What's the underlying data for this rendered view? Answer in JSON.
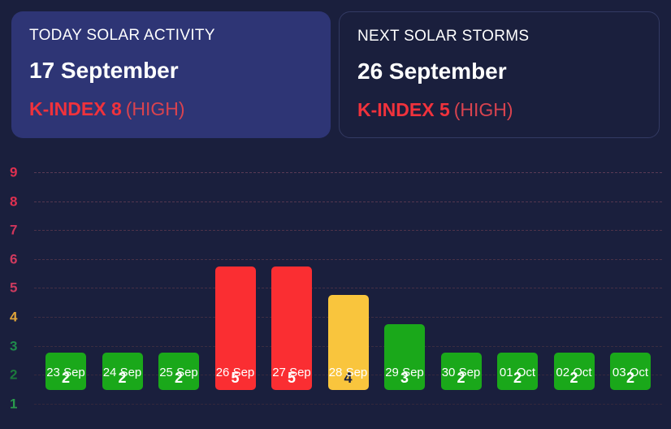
{
  "cards": [
    {
      "title": "TODAY SOLAR ACTIVITY",
      "date": "17 September",
      "kindex": "K-INDEX 8",
      "level": "(HIGH)",
      "style": "filled"
    },
    {
      "title": "NEXT SOLAR STORMS",
      "date": "26 September",
      "kindex": "K-INDEX 5",
      "level": "(HIGH)",
      "style": "outline"
    }
  ],
  "colors": {
    "background": "#1a1f3d",
    "card_filled": "#2e3575",
    "card_border": "#333a63",
    "red": "#fa2e32",
    "yellow": "#f9c53d",
    "green": "#1aa81a",
    "kindex_red": "#f0323c",
    "level_red": "#d8434f"
  },
  "chart_data": {
    "type": "bar",
    "title": "",
    "xlabel": "",
    "ylabel": "",
    "categories": [
      "23 Sep",
      "24 Sep",
      "25 Sep",
      "26 Sep",
      "27 Sep",
      "28 Sep",
      "29 Sep",
      "30 Sep",
      "01 Oct",
      "02 Oct",
      "03 Oct"
    ],
    "values": [
      2,
      2,
      2,
      5,
      5,
      4,
      3,
      2,
      2,
      2,
      2
    ],
    "bar_colors": [
      "#1aa81a",
      "#1aa81a",
      "#1aa81a",
      "#fa2e32",
      "#fa2e32",
      "#f9c53d",
      "#1aa81a",
      "#1aa81a",
      "#1aa81a",
      "#1aa81a",
      "#1aa81a"
    ],
    "value_label_colors": [
      "#ffffff",
      "#ffffff",
      "#ffffff",
      "#ffffff",
      "#ffffff",
      "#1a1f3d",
      "#ffffff",
      "#ffffff",
      "#ffffff",
      "#ffffff",
      "#ffffff"
    ],
    "ylim": [
      1,
      9
    ],
    "yticks": [
      9,
      8,
      7,
      6,
      5,
      4,
      3,
      2,
      1
    ],
    "ytick_colors": [
      "#e03050",
      "#e03050",
      "#d0355c",
      "#d03a5e",
      "#cc3b5f",
      "#e0a53a",
      "#1f8a4c",
      "#1c7a3c",
      "#2a9a4c"
    ],
    "gridline_colors": [
      "#5a3a55",
      "#54364f",
      "#4e3349",
      "#4a3247",
      "#453045",
      "#3f2e42",
      "#3a2c40",
      "#36293d",
      "#33283b"
    ],
    "grid": true,
    "legend": null
  }
}
